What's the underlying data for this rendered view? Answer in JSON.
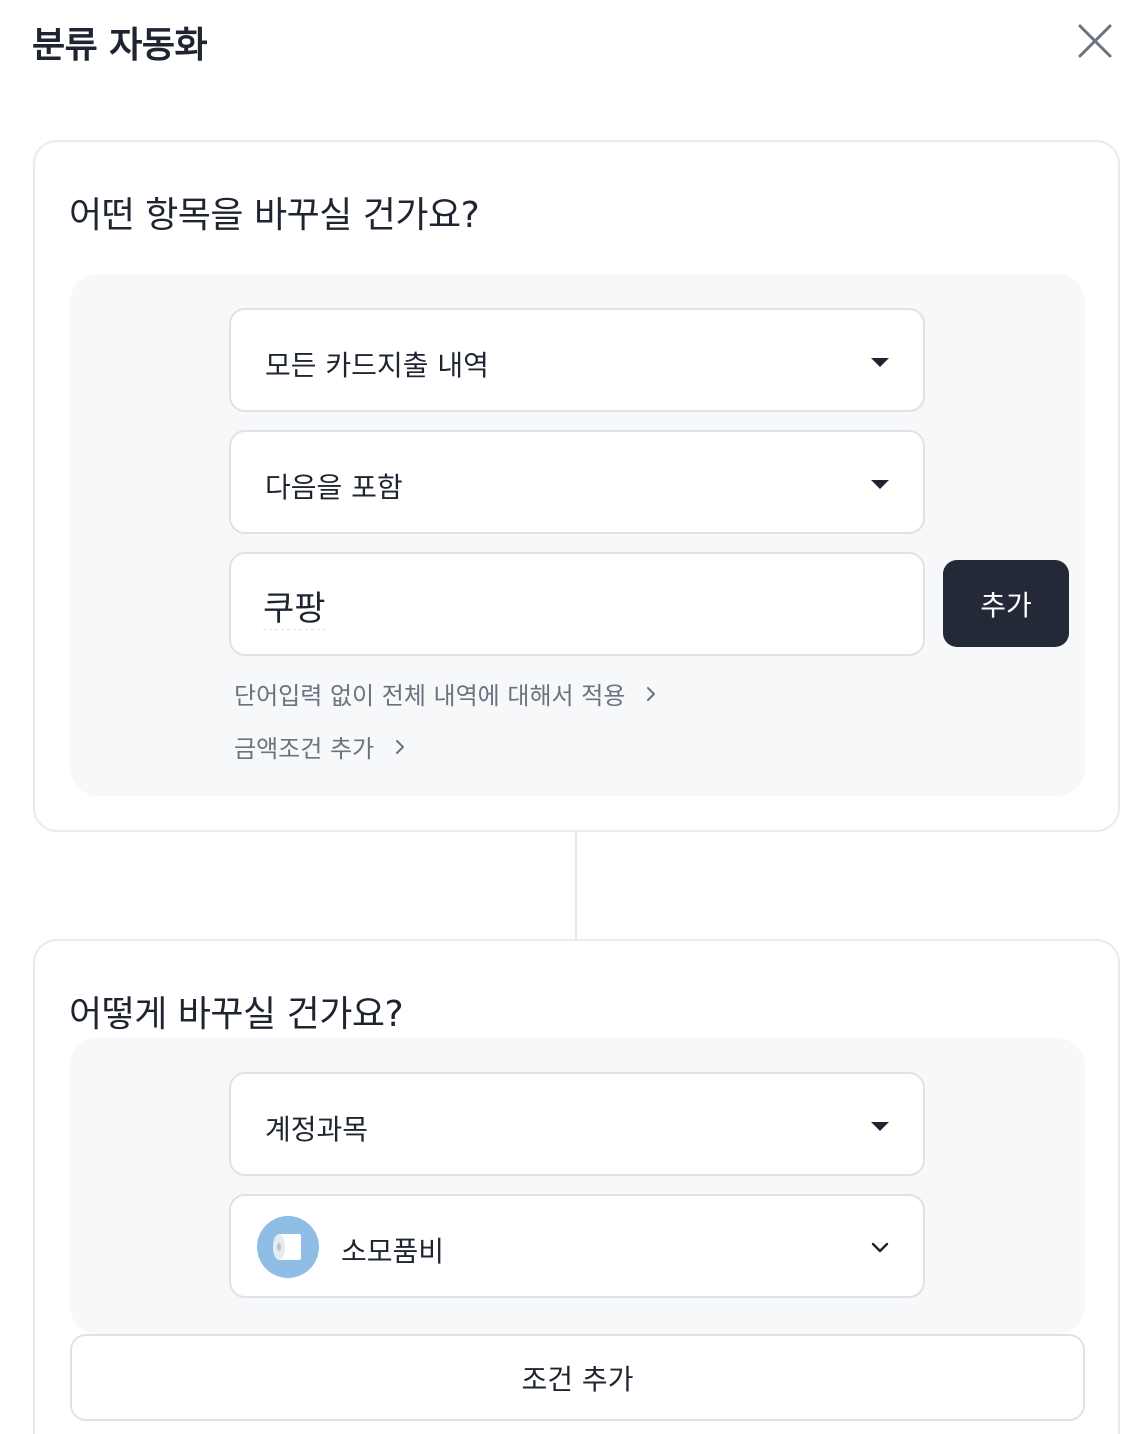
{
  "header": {
    "title": "분류 자동화"
  },
  "target_section": {
    "title": "어떤 항목을 바꾸실 건가요?",
    "source_select": "모든 카드지출 내역",
    "match_select": "다음을 포함",
    "keyword_value": "쿠팡",
    "add_button": "추가",
    "link_apply_all": "단어입력 없이 전체 내역에 대해서 적용",
    "link_amount": "금액조건 추가"
  },
  "change_section": {
    "title": "어떻게 바꾸실 건가요?",
    "field_select": "계정과목",
    "category_select": "소모품비",
    "category_icon": "toilet-paper-icon",
    "add_condition_button": "조건 추가"
  },
  "colors": {
    "primary_button": "#232936",
    "panel_bg": "#f7f8f9",
    "border": "#dfe2e6",
    "avatar_bg": "#8fbde6"
  }
}
